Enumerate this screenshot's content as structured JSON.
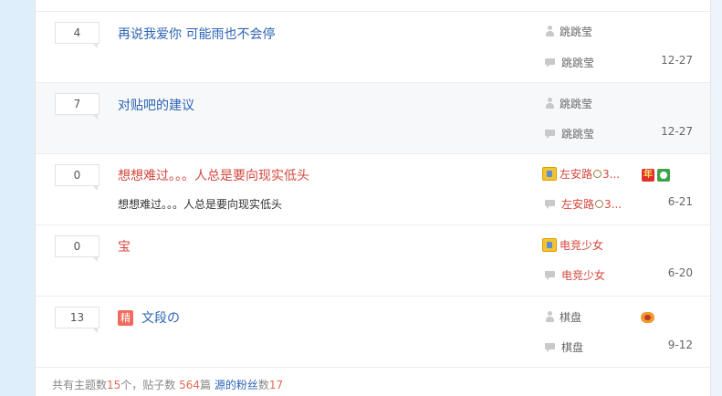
{
  "threads": [
    {
      "replies": "4",
      "title": "再说我爱你 可能雨也不会停",
      "author": "跳跳莹",
      "last_reply": "跳跳莹",
      "date": "12-27"
    },
    {
      "replies": "7",
      "title": "对贴吧的建议",
      "author": "跳跳莹",
      "last_reply": "跳跳莹",
      "date": "12-27"
    },
    {
      "replies": "0",
      "title": "想想难过。。。人总是要向现实低头",
      "abstract": "想想难过。。。人总是要向现实低头",
      "author": "左安路",
      "author_suffix": "3...",
      "last_reply": "左安路",
      "last_reply_suffix": "3...",
      "date": "6-21",
      "badge_nian": "年"
    },
    {
      "replies": "0",
      "title": "宝",
      "author": "电竞少女",
      "last_reply": "电竞少女",
      "date": "6-20"
    },
    {
      "replies": "13",
      "jing": "精",
      "title": "文段の",
      "author": "棋盘",
      "last_reply": "棋盘",
      "date": "9-12"
    }
  ],
  "footer": {
    "p1": "共有主题数",
    "topics": "15",
    "p2": "个，贴子数 ",
    "posts": "564",
    "p3": "篇 ",
    "fans_link": "源的粉丝",
    "p4": "数",
    "fans": "17"
  },
  "colors": {
    "link_blue": "#2d64b3",
    "red": "#d4473e",
    "highlight_row": "#f7f8fa",
    "side_bg": "#dfeefb"
  },
  "icons": [
    "user-icon",
    "reply-bubble-icon",
    "level-badge-icon",
    "nian-badge-icon",
    "game-badge-icon"
  ]
}
